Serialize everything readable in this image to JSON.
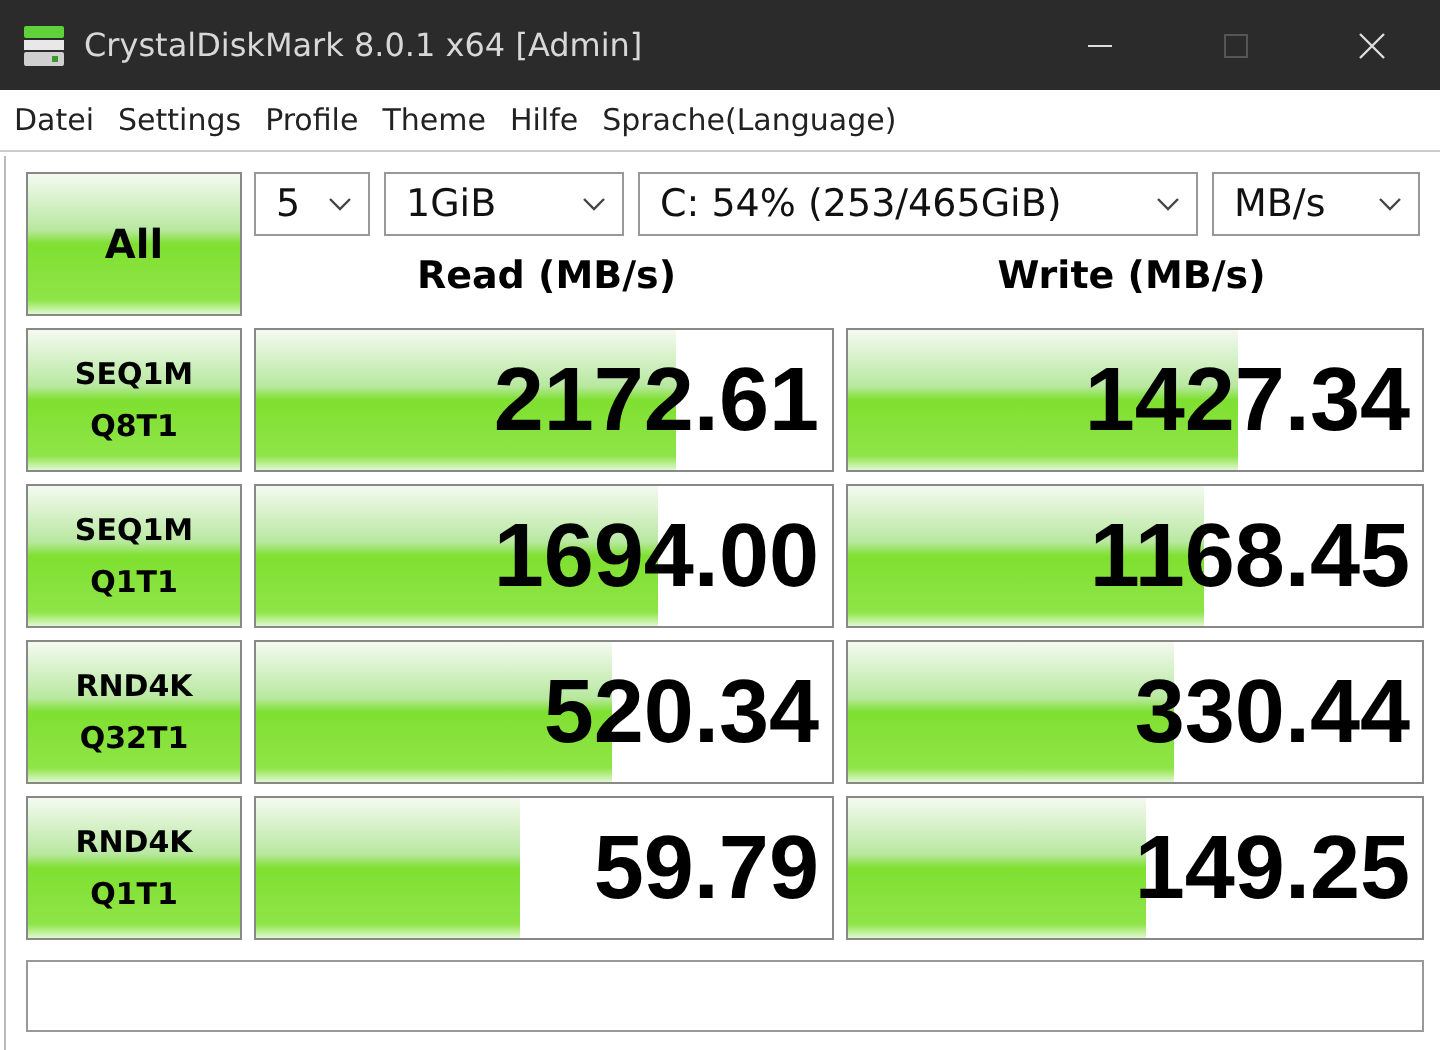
{
  "window": {
    "title": "CrystalDiskMark 8.0.1 x64 [Admin]"
  },
  "menu": [
    "Datei",
    "Settings",
    "Profile",
    "Theme",
    "Hilfe",
    "Sprache(Language)"
  ],
  "all_button": "All",
  "selectors": [
    {
      "value": "5"
    },
    {
      "value": "1GiB"
    },
    {
      "value": "C: 54% (253/465GiB)"
    },
    {
      "value": "MB/s"
    }
  ],
  "headers": {
    "read": "Read (MB/s)",
    "write": "Write (MB/s)"
  },
  "rows": [
    {
      "label_1": "SEQ1M",
      "label_2": "Q8T1",
      "read": {
        "value": "2172.61",
        "level": 0.73
      },
      "write": {
        "value": "1427.34",
        "level": 0.68
      }
    },
    {
      "label_1": "SEQ1M",
      "label_2": "Q1T1",
      "read": {
        "value": "1694.00",
        "level": 0.7
      },
      "write": {
        "value": "1168.45",
        "level": 0.62
      }
    },
    {
      "label_1": "RND4K",
      "label_2": "Q32T1",
      "read": {
        "value": "520.34",
        "level": 0.62
      },
      "write": {
        "value": "330.44",
        "level": 0.57
      }
    },
    {
      "label_1": "RND4K",
      "label_2": "Q1T1",
      "read": {
        "value": "59.79",
        "level": 0.46
      },
      "write": {
        "value": "149.25",
        "level": 0.52
      }
    }
  ]
}
